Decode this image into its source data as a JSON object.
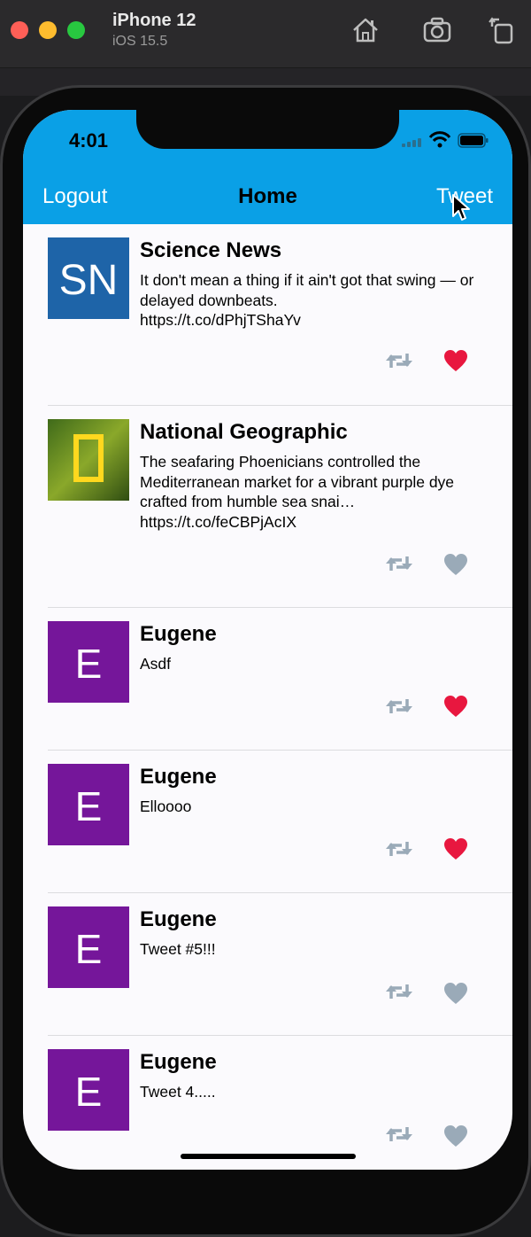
{
  "simulator": {
    "device_name": "iPhone 12",
    "os_version": "iOS 15.5",
    "toolbar_icons": [
      "home-icon",
      "screenshot-icon",
      "rotate-icon"
    ]
  },
  "status_bar": {
    "time": "4:01",
    "icons": [
      "signal-icon",
      "wifi-icon",
      "battery-icon"
    ]
  },
  "nav": {
    "left_button": "Logout",
    "title": "Home",
    "right_button": "Tweet",
    "background_color": "#0aa0e6"
  },
  "tweets": [
    {
      "name": "Science News",
      "avatar": "SN",
      "text": "It don't mean a thing if it ain't got that swing — or delayed downbeats.\n https://t.co/dPhjTShaYv",
      "liked": true
    },
    {
      "name": "National Geographic",
      "avatar": "NG",
      "text": "The seafaring Phoenicians controlled the Mediterranean market for a vibrant purple dye crafted from humble sea snai… https://t.co/feCBPjAcIX",
      "liked": false
    },
    {
      "name": "Eugene",
      "avatar": "E",
      "text": "Asdf",
      "liked": true
    },
    {
      "name": "Eugene",
      "avatar": "E",
      "text": "Elloooo",
      "liked": true
    },
    {
      "name": "Eugene",
      "avatar": "E",
      "text": "Tweet #5!!!",
      "liked": false
    },
    {
      "name": "Eugene",
      "avatar": "E",
      "text": "Tweet 4.....",
      "liked": false
    }
  ],
  "colors": {
    "liked": "#e8173f",
    "unliked": "#9aaab8",
    "retweet": "#9aaab8",
    "avatar_purple": "#75169a"
  }
}
